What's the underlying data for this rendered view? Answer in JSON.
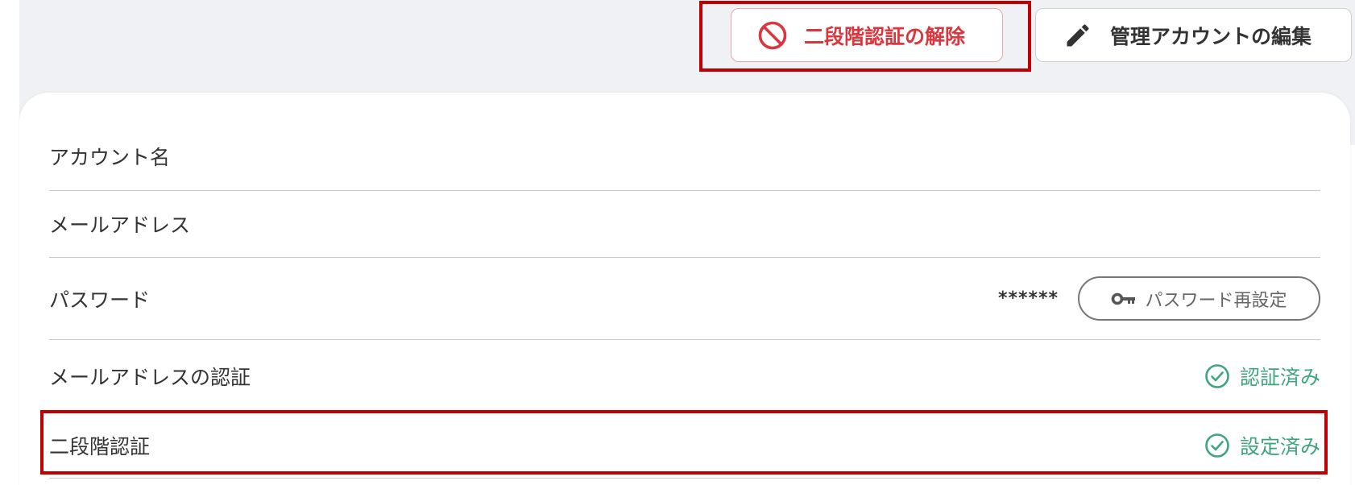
{
  "header": {
    "disable_2fa_button": {
      "label": "二段階認証の解除",
      "icon": "block-icon",
      "color": "#d9363e"
    },
    "edit_admin_button": {
      "label": "管理アカウントの編集",
      "icon": "pencil-icon"
    }
  },
  "rows": [
    {
      "label": "アカウント名"
    },
    {
      "label": "メールアドレス"
    },
    {
      "label": "パスワード",
      "value": "******",
      "action": {
        "label": "パスワード再設定",
        "icon": "key-icon"
      }
    },
    {
      "label": "メールアドレスの認証",
      "status": {
        "label": "認証済み",
        "icon": "check-circle-icon",
        "color": "#3fa57f"
      }
    },
    {
      "label": "二段階認証",
      "status": {
        "label": "設定済み",
        "icon": "check-circle-icon",
        "color": "#3fa57f"
      }
    }
  ],
  "highlight_color": "#c00000"
}
